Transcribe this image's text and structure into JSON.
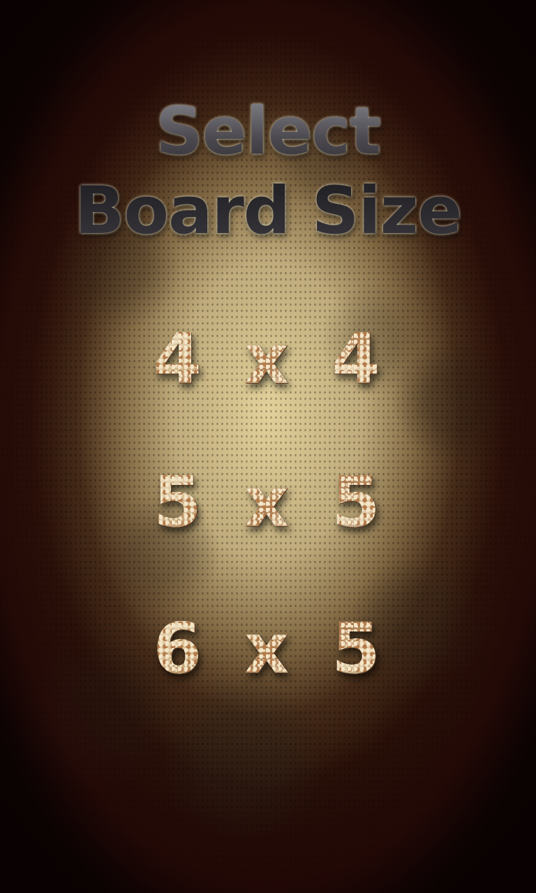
{
  "screen": {
    "title_line1": "Select",
    "title_line2": "Board Size"
  },
  "options": [
    {
      "label": "4 x 4"
    },
    {
      "label": "5 x 5"
    },
    {
      "label": "6 x 5"
    }
  ],
  "colors": {
    "background_center": "#e8d8a0",
    "background_edge": "#120605",
    "title_text": "#2c2b2e",
    "option_text": "#d2b88e"
  }
}
